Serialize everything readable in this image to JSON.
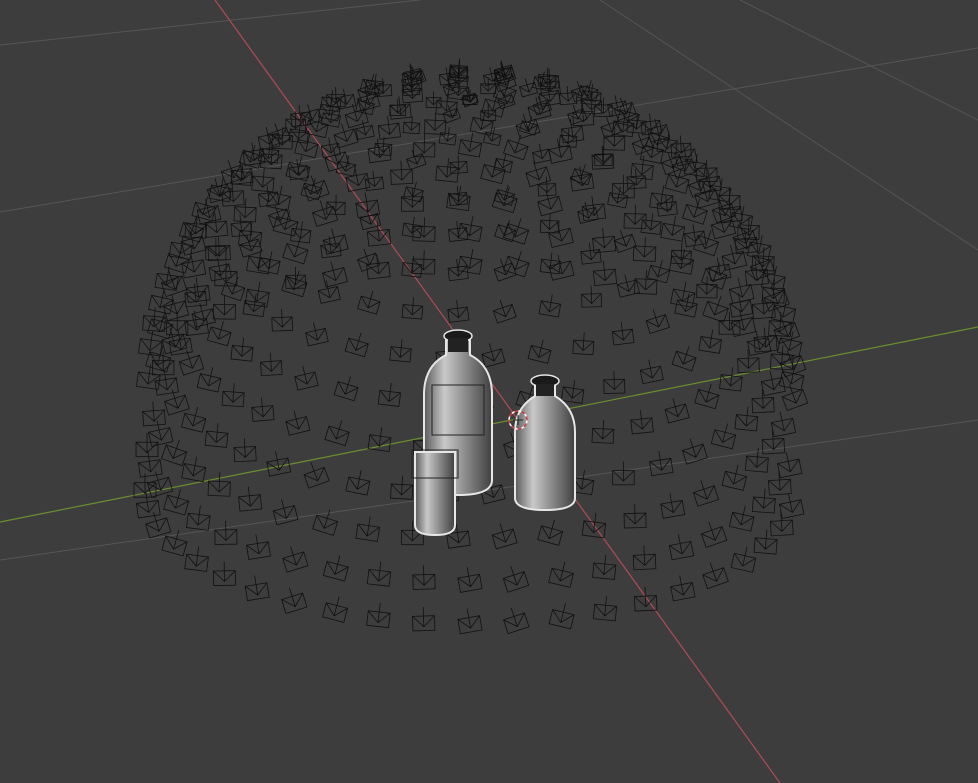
{
  "viewport": {
    "kind": "3d-viewport",
    "background_color": "#3d3d3d",
    "grid_color": "#555555",
    "x_axis_color": "#b04a55",
    "y_axis_color": "#6b8f2f",
    "wire_color": "#111111",
    "selection_outline_color": "#e6e6e6",
    "cursor_color": "#d04040"
  },
  "scene": {
    "objects": [
      {
        "name": "camera-dome",
        "type": "camera-array",
        "icon": "camera-icon",
        "selected": false
      },
      {
        "name": "bottle-large",
        "type": "mesh",
        "selected": true
      },
      {
        "name": "bottle-medium",
        "type": "mesh",
        "selected": true
      },
      {
        "name": "bottle-small",
        "type": "mesh",
        "selected": true
      }
    ],
    "cursor": {
      "icon": "3d-cursor-icon"
    }
  }
}
